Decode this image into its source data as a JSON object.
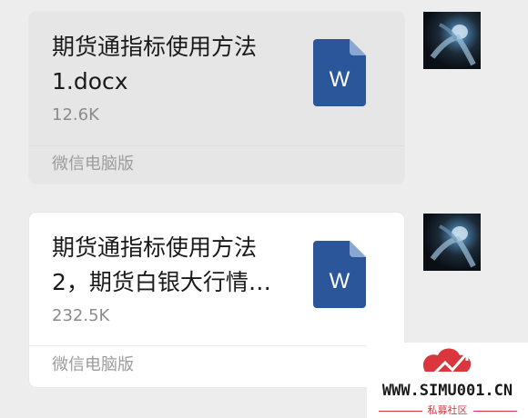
{
  "messages": [
    {
      "title": "期货通指标使用方法1.docx",
      "size": "12.6K",
      "source": "微信电脑版",
      "icon": "word-document-icon",
      "icon_letter": "W",
      "icon_color": "#2b579a"
    },
    {
      "title": "期货通指标使用方法2，期货白银大行情…",
      "size": "232.5K",
      "source": "微信电脑版",
      "icon": "word-document-icon",
      "icon_letter": "W",
      "icon_color": "#2b579a"
    }
  ],
  "watermark": {
    "site": "WWW.SIMU001.CN",
    "subtitle": "私募社区",
    "color": "#d9363e"
  }
}
